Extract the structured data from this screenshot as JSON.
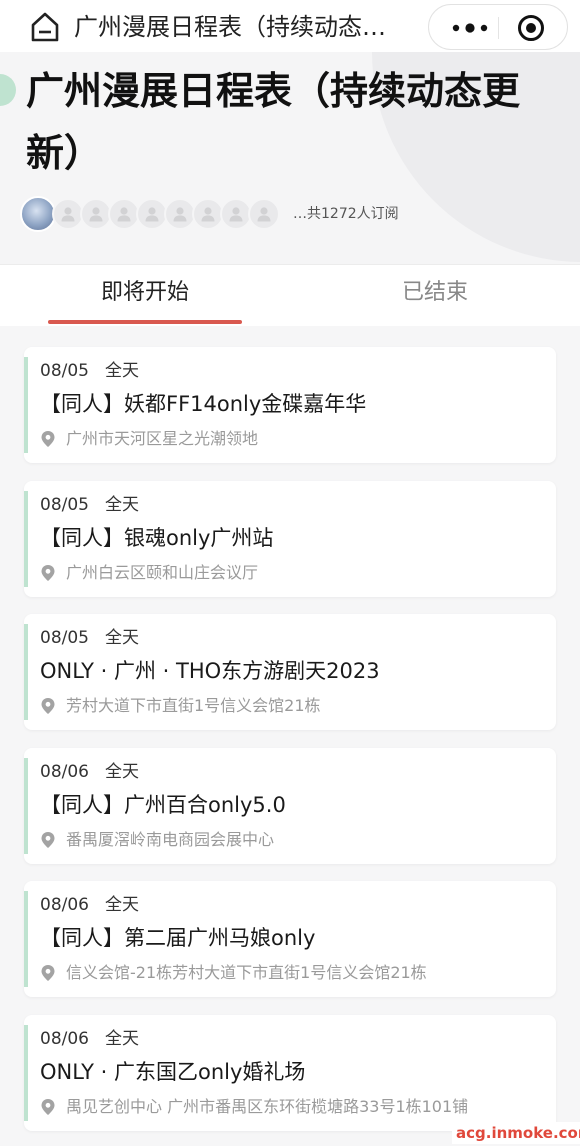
{
  "top_bar": {
    "title": "广州漫展日程表（持续动态…",
    "home_icon": "home-icon",
    "more_icon": "more-dots-icon",
    "close_icon": "close-target-icon"
  },
  "header": {
    "title": "广州漫展日程表（持续动态更新）",
    "subscriber_text": "…共1272人订阅",
    "placeholder_avatar_count": 8
  },
  "tabs": [
    {
      "label": "即将开始",
      "active": true
    },
    {
      "label": "已结束",
      "active": false
    }
  ],
  "events": [
    {
      "date": "08/05",
      "time": "全天",
      "title": "【同人】妖都FF14only金碟嘉年华",
      "location": "广州市天河区星之光潮领地"
    },
    {
      "date": "08/05",
      "time": "全天",
      "title": "【同人】银魂only广州站",
      "location": "广州白云区颐和山庄会议厅"
    },
    {
      "date": "08/05",
      "time": "全天",
      "title": "ONLY · 广州 · THO东方游剧天2023",
      "location": "芳村大道下市直街1号信义会馆21栋"
    },
    {
      "date": "08/06",
      "time": "全天",
      "title": "【同人】广州百合only5.0",
      "location": "番禺厦滘岭南电商园会展中心"
    },
    {
      "date": "08/06",
      "time": "全天",
      "title": "【同人】第二届广州马娘only",
      "location": "信义会馆-21栋芳村大道下市直街1号信义会馆21栋"
    },
    {
      "date": "08/06",
      "time": "全天",
      "title": "ONLY · 广东国乙only婚礼场",
      "location": "禺见艺创中心 广州市番禺区东环街榄塘路33号1栋101铺"
    }
  ],
  "colors": {
    "accent_red": "#d9594f",
    "accent_mint": "#bfe3d0",
    "watermark_red": "#e0483b"
  },
  "watermark": "acg.inmoke.com"
}
